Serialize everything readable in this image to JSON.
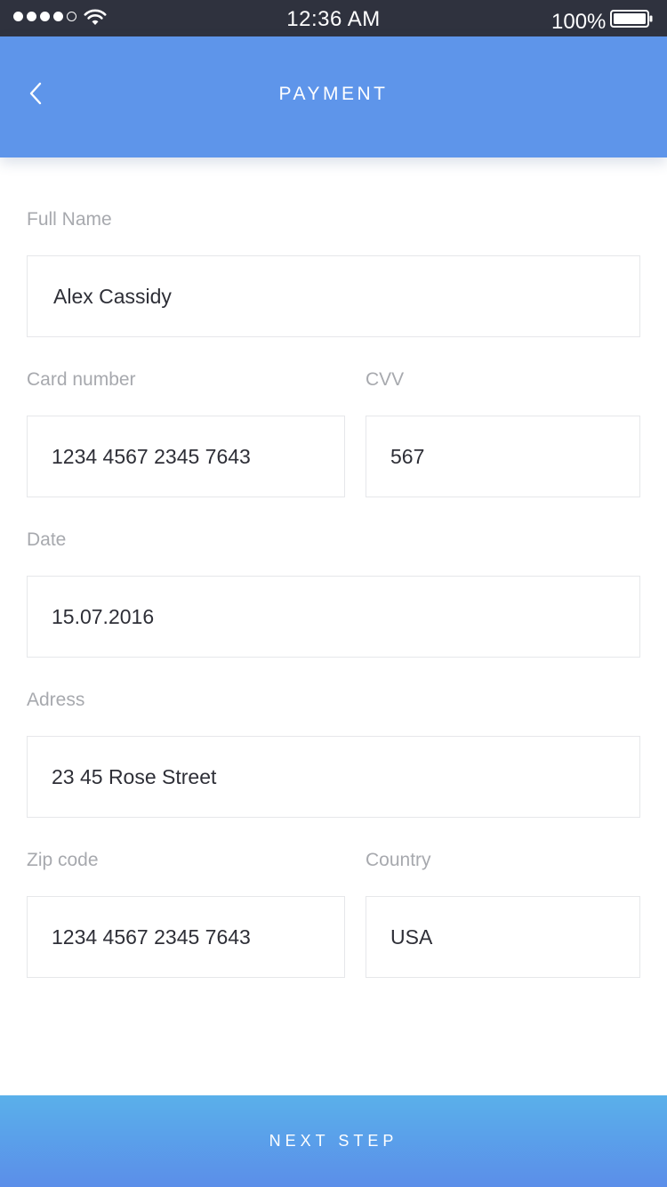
{
  "status_bar": {
    "time": "12:36 AM",
    "battery": "100%",
    "signal_bars_filled": 4,
    "signal_bars_total": 5,
    "icons": [
      "signal-dots-icon",
      "wifi-icon",
      "battery-icon"
    ]
  },
  "header": {
    "title": "PAYMENT",
    "back_icon": "chevron-left-icon",
    "color": "#5e95ea"
  },
  "form": {
    "full_name": {
      "label": "Full Name",
      "value": "Alex Cassidy"
    },
    "card_number": {
      "label": "Card number",
      "value": "1234 4567 2345 7643"
    },
    "cvv": {
      "label": "CVV",
      "value": "567"
    },
    "date": {
      "label": "Date",
      "value": "15.07.2016"
    },
    "address": {
      "label": "Adress",
      "value": "23 45 Rose Street"
    },
    "zip_code": {
      "label": "Zip code",
      "value": "1234 4567 2345 7643"
    },
    "country": {
      "label": "Country",
      "value": "USA"
    }
  },
  "footer": {
    "next_label": "NEXT STEP"
  }
}
